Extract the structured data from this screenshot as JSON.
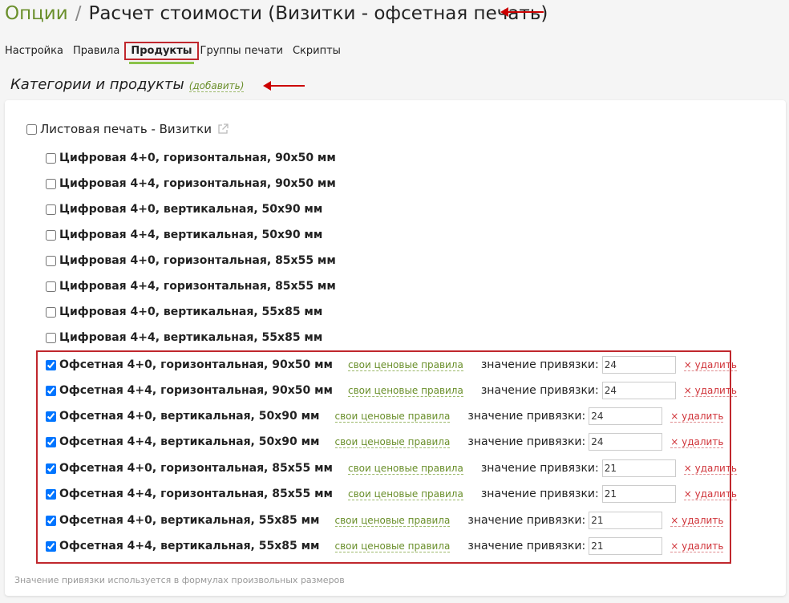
{
  "header": {
    "parent_link": "Опции",
    "separator": "/",
    "title": "Расчет стоимости (Визитки - офсетная печать)"
  },
  "tabs": [
    {
      "label": "Настройка"
    },
    {
      "label": "Правила"
    },
    {
      "label": "Продукты",
      "active": true
    },
    {
      "label": "Группы печати"
    },
    {
      "label": "Скрипты"
    }
  ],
  "section": {
    "title": "Категории и продукты",
    "add_link": "(добавить)"
  },
  "category": {
    "label": "Листовая печать - Визитки",
    "checked": false
  },
  "products_unchecked": [
    {
      "label": "Цифровая 4+0, горизонтальная, 90x50 мм"
    },
    {
      "label": "Цифровая 4+4, горизонтальная, 90x50 мм"
    },
    {
      "label": "Цифровая 4+0, вертикальная, 50x90 мм"
    },
    {
      "label": "Цифровая 4+4, вертикальная, 50x90 мм"
    },
    {
      "label": "Цифровая 4+0, горизонтальная, 85x55 мм"
    },
    {
      "label": "Цифровая 4+4, горизонтальная, 85x55 мм"
    },
    {
      "label": "Цифровая 4+0, вертикальная, 55x85 мм"
    },
    {
      "label": "Цифровая 4+4, вертикальная, 55x85 мм"
    }
  ],
  "products_checked": [
    {
      "label": "Офсетная 4+0, горизонтальная, 90x50 мм",
      "value": "24"
    },
    {
      "label": "Офсетная 4+4, горизонтальная, 90x50 мм",
      "value": "24"
    },
    {
      "label": "Офсетная 4+0, вертикальная, 50x90 мм",
      "value": "24"
    },
    {
      "label": "Офсетная 4+4, вертикальная, 50x90 мм",
      "value": "24"
    },
    {
      "label": "Офсетная 4+0, горизонтальная, 85x55 мм",
      "value": "21"
    },
    {
      "label": "Офсетная 4+4, горизонтальная, 85x55 мм",
      "value": "21"
    },
    {
      "label": "Офсетная 4+0, вертикальная, 55x85 мм",
      "value": "21"
    },
    {
      "label": "Офсетная 4+4, вертикальная, 55x85 мм",
      "value": "21"
    }
  ],
  "row_texts": {
    "rules_link": "свои ценовые правила",
    "binding_label": "значение привязки:",
    "delete_link": "× удалить"
  },
  "footnote": "Значение привязки используется в формулах произвольных размеров",
  "colors": {
    "accent_green": "#6a8f2b",
    "highlight_red": "#c0272d",
    "delete_red": "#d0343a"
  }
}
